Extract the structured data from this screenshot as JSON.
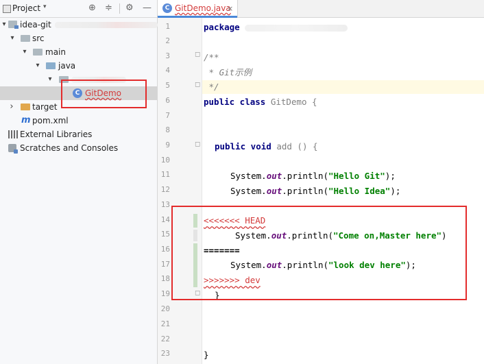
{
  "project_panel": {
    "title": "Project",
    "dropdown_glyph": "▾",
    "header_icons": [
      "target-icon",
      "settings-collapse-icon",
      "gear-icon",
      "minimize-icon"
    ],
    "header_icon_glyphs": [
      "⊕",
      "≑",
      "⚙",
      "—"
    ],
    "tree": [
      {
        "label": "idea-git",
        "arrow": "▾",
        "icon": "module-folder-icon"
      },
      {
        "label": "src",
        "arrow": "▾",
        "icon": "folder-icon"
      },
      {
        "label": "main",
        "arrow": "▾",
        "icon": "folder-icon"
      },
      {
        "label": "java",
        "arrow": "▾",
        "icon": "source-folder-icon"
      },
      {
        "label": "",
        "arrow": "▾",
        "icon": "package-icon"
      },
      {
        "label": "GitDemo",
        "arrow": "",
        "icon": "class-icon"
      },
      {
        "label": "target",
        "arrow": "›",
        "icon": "folder-icon"
      },
      {
        "label": "pom.xml",
        "arrow": "",
        "icon": "maven-icon"
      },
      {
        "label": "External Libraries",
        "arrow": "",
        "icon": "libraries-icon"
      },
      {
        "label": "Scratches and Consoles",
        "arrow": "",
        "icon": "scratches-icon"
      }
    ]
  },
  "editor": {
    "tab": {
      "label": "GitDemo.java",
      "close_glyph": "×"
    },
    "line_numbers": [
      "1",
      "2",
      "3",
      "4",
      "5",
      "6",
      "7",
      "8",
      "9",
      "10",
      "11",
      "12",
      "13",
      "14",
      "15",
      "16",
      "17",
      "18",
      "19",
      "20",
      "21",
      "22",
      "23"
    ],
    "code": {
      "l1": "package",
      "l3": "/**",
      "l4": " * Git示例",
      "l5": " */",
      "l6_kw": "public class",
      "l6_name": " GitDemo {",
      "l9_kw": "public void",
      "l9_name": " add () {",
      "l11_pre": "System.",
      "l11_field": "out",
      "l11_mid": ".println(",
      "l11_str": "\"Hello Git\"",
      "l11_end": ");",
      "l12_pre": "System.",
      "l12_field": "out",
      "l12_mid": ".println(",
      "l12_str": "\"Hello Idea\"",
      "l12_end": ");",
      "l14": "<<<<<<< HEAD",
      "l15_pre": "System.",
      "l15_field": "out",
      "l15_mid": ".println(",
      "l15_str": "\"Come on,Master here\"",
      "l15_end": ")",
      "l16": "=======",
      "l17_pre": "System.",
      "l17_field": "out",
      "l17_mid": ".println(",
      "l17_str": "\"look dev here\"",
      "l17_end": ");",
      "l18": ">>>>>>> dev",
      "l19": "}",
      "l23": "}"
    }
  },
  "colors": {
    "annotation_red": "#e32b2b",
    "keyword": "#000080",
    "string": "#008000",
    "field": "#660e7a",
    "conflict": "#d33b3b",
    "current_line": "#fffae3"
  }
}
